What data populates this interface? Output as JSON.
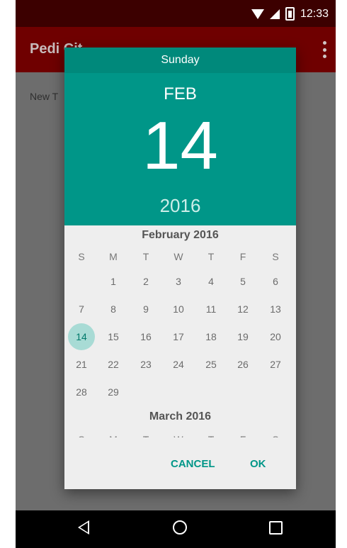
{
  "status_bar": {
    "time": "12:33",
    "icons": [
      "wifi-icon",
      "signal-icon",
      "battery-icon"
    ]
  },
  "app_bar": {
    "title": "Pedi Cit",
    "menu_icon": "more-vert-icon"
  },
  "content": {
    "first_item": "New T"
  },
  "dialog": {
    "day_of_week": "Sunday",
    "month": "FEB",
    "day": "14",
    "year": "2016",
    "calendar_title": "February 2016",
    "next_calendar_title": "March 2016",
    "weekdays": [
      "S",
      "M",
      "T",
      "W",
      "T",
      "F",
      "S"
    ],
    "weeks": [
      [
        "",
        "1",
        "2",
        "3",
        "4",
        "5",
        "6"
      ],
      [
        "7",
        "8",
        "9",
        "10",
        "11",
        "12",
        "13"
      ],
      [
        "14",
        "15",
        "16",
        "17",
        "18",
        "19",
        "20"
      ],
      [
        "21",
        "22",
        "23",
        "24",
        "25",
        "26",
        "27"
      ],
      [
        "28",
        "29",
        "",
        "",
        "",
        "",
        ""
      ]
    ],
    "selected_day": "14",
    "buttons": {
      "cancel": "CANCEL",
      "ok": "OK"
    },
    "colors": {
      "header": "#009688",
      "header_dark": "#00897b",
      "selection": "#a8dbd5",
      "accent": "#009688"
    }
  },
  "nav_bar": {
    "icons": [
      "back-icon",
      "home-icon",
      "recents-icon"
    ]
  }
}
